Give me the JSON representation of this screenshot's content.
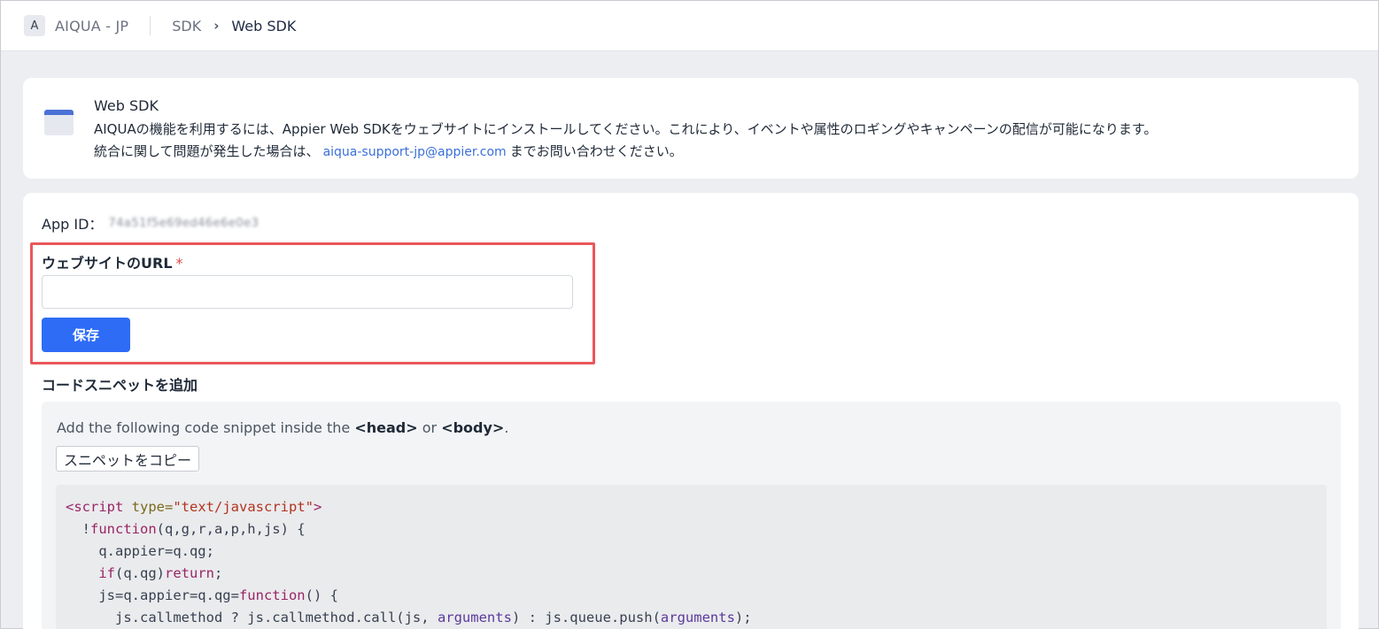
{
  "header": {
    "account_initial": "A",
    "account_name": "AIQUA - JP",
    "breadcrumb_parent": "SDK",
    "breadcrumb_separator": "›",
    "breadcrumb_current": "Web SDK"
  },
  "info": {
    "icon": "browser-window-icon",
    "title": "Web SDK",
    "line1": "AIQUAの機能を利用するには、Appier Web SDKをウェブサイトにインストールしてください。これにより、イベントや属性のロギングやキャンペーンの配信が可能になります。",
    "line2_prefix": "統合に関して問題が発生した場合は、",
    "support_email": "aiqua-support-jp@appier.com",
    "line2_suffix": "までお問い合わせください。"
  },
  "app": {
    "app_id_label": "App ID：",
    "app_id_value": "74a51f5e69ed46e6e0e3"
  },
  "url_form": {
    "label": "ウェブサイトのURL",
    "required_mark": "*",
    "value": "",
    "placeholder": "",
    "save_label": "保存"
  },
  "snippet": {
    "heading": "コードスニペットを追加",
    "instruction_prefix": "Add the following code snippet inside the ",
    "instruction_head": "<head>",
    "instruction_or": " or ",
    "instruction_body": "<body>",
    "instruction_suffix": ".",
    "copy_label": "スニペットをコピー",
    "code": {
      "l1_tag_open": "<script",
      "l1_attr": "type=",
      "l1_str": "\"text/javascript\"",
      "l1_tag_close": ">",
      "l2_prefix": "  !",
      "l2_kw": "function",
      "l2_rest": "(q,g,r,a,p,h,js) {",
      "l3": "    q.appier=q.qg;",
      "l4_indent": "    ",
      "l4_kw": "if",
      "l4_mid": "(q.qg)",
      "l4_kw2": "return",
      "l4_end": ";",
      "l5_prefix": "    js=q.appier=q.qg=",
      "l5_kw": "function",
      "l5_rest": "() {",
      "l6_a": "      js.callmethod ? js.callmethod.call(js, ",
      "l6_arg1": "arguments",
      "l6_b": ") : js.queue.push(",
      "l6_arg2": "arguments",
      "l6_c": ");"
    }
  }
}
